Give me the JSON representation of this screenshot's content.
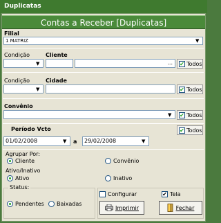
{
  "window": {
    "title": "Duplicatas"
  },
  "header": {
    "banner": "Contas a Receber [Duplicatas]"
  },
  "filial": {
    "label": "Filial",
    "value": "1 MATRIZ"
  },
  "cliente": {
    "condicao_label": "Condição",
    "label": "Cliente",
    "condicao_value": "",
    "code_value": "",
    "name_value": "",
    "todos_label": "Todos",
    "ellipsis": "..."
  },
  "cidade": {
    "condicao_label": "Condição",
    "label": "Cidade",
    "condicao_value": "",
    "value": "",
    "todos_label": "Todos"
  },
  "convenio": {
    "label": "Convênio",
    "value": "",
    "todos_label": "Todos"
  },
  "periodo": {
    "label": "Período Vcto",
    "from": "01/02/2008",
    "separator": "a",
    "to": "29/02/2008",
    "todos_label": "Todos"
  },
  "agrupar": {
    "label": "Agrupar Por:",
    "options": [
      "Cliente",
      "Convênio"
    ],
    "selected": "Cliente"
  },
  "ativo": {
    "label": "Ativo/Inativo",
    "options": [
      "Ativo",
      "Inativo"
    ],
    "selected": "Ativo"
  },
  "status": {
    "label": "Status:",
    "options": [
      "Pendentes",
      "Baixadas"
    ],
    "selected": "Pendentes"
  },
  "options": {
    "configurar_label": "Configurar",
    "configurar_checked": false,
    "tela_label": "Tela",
    "tela_checked": true
  },
  "buttons": {
    "imprimir": "Imprimir",
    "fechar": "Fechar"
  },
  "colors": {
    "titlebar": "#3f7a2f",
    "banner": "#4a8a3a",
    "form_bg": "#e7e4d5",
    "check_green": "#21a121"
  }
}
